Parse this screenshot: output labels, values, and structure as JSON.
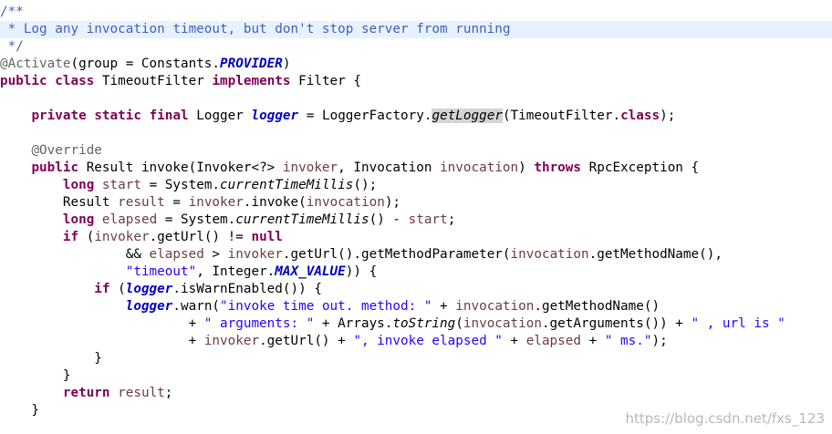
{
  "editor": {
    "highlighted_line": 1,
    "lines": [
      [
        {
          "t": "/**",
          "k": "comment"
        }
      ],
      [
        {
          "t": " * Log any invocation timeout, but don't stop server from running",
          "k": "comment"
        }
      ],
      [
        {
          "t": " */",
          "k": "comment"
        }
      ],
      [
        {
          "t": "@Activate",
          "k": "annotation"
        },
        {
          "t": "(group = Constants.",
          "k": "plain"
        },
        {
          "t": "PROVIDER",
          "k": "static-constant"
        },
        {
          "t": ")",
          "k": "plain"
        }
      ],
      [
        {
          "t": "public",
          "k": "keyword"
        },
        {
          "t": " ",
          "k": "plain"
        },
        {
          "t": "class",
          "k": "keyword"
        },
        {
          "t": " TimeoutFilter ",
          "k": "plain"
        },
        {
          "t": "implements",
          "k": "keyword"
        },
        {
          "t": " Filter {",
          "k": "plain"
        }
      ],
      [],
      [
        {
          "t": "    ",
          "k": "plain"
        },
        {
          "t": "private",
          "k": "keyword"
        },
        {
          "t": " ",
          "k": "plain"
        },
        {
          "t": "static",
          "k": "keyword"
        },
        {
          "t": " ",
          "k": "plain"
        },
        {
          "t": "final",
          "k": "keyword"
        },
        {
          "t": " Logger ",
          "k": "plain"
        },
        {
          "t": "logger",
          "k": "static-field"
        },
        {
          "t": " = LoggerFactory.",
          "k": "plain"
        },
        {
          "t": "getLogger",
          "k": "static-method-marked"
        },
        {
          "t": "(TimeoutFilter.",
          "k": "plain"
        },
        {
          "t": "class",
          "k": "keyword"
        },
        {
          "t": ");",
          "k": "plain"
        }
      ],
      [],
      [
        {
          "t": "    ",
          "k": "plain"
        },
        {
          "t": "@Override",
          "k": "annotation"
        }
      ],
      [
        {
          "t": "    ",
          "k": "plain"
        },
        {
          "t": "public",
          "k": "keyword"
        },
        {
          "t": " Result invoke(Invoker<?> ",
          "k": "plain"
        },
        {
          "t": "invoker",
          "k": "local"
        },
        {
          "t": ", Invocation ",
          "k": "plain"
        },
        {
          "t": "invocation",
          "k": "local"
        },
        {
          "t": ") ",
          "k": "plain"
        },
        {
          "t": "throws",
          "k": "keyword"
        },
        {
          "t": " RpcException {",
          "k": "plain"
        }
      ],
      [
        {
          "t": "        ",
          "k": "plain"
        },
        {
          "t": "long",
          "k": "keyword"
        },
        {
          "t": " ",
          "k": "plain"
        },
        {
          "t": "start",
          "k": "local"
        },
        {
          "t": " = System.",
          "k": "plain"
        },
        {
          "t": "currentTimeMillis",
          "k": "static-method"
        },
        {
          "t": "();",
          "k": "plain"
        }
      ],
      [
        {
          "t": "        Result ",
          "k": "plain"
        },
        {
          "t": "result",
          "k": "local"
        },
        {
          "t": " = ",
          "k": "plain"
        },
        {
          "t": "invoker",
          "k": "local"
        },
        {
          "t": ".invoke(",
          "k": "plain"
        },
        {
          "t": "invocation",
          "k": "local"
        },
        {
          "t": ");",
          "k": "plain"
        }
      ],
      [
        {
          "t": "        ",
          "k": "plain"
        },
        {
          "t": "long",
          "k": "keyword"
        },
        {
          "t": " ",
          "k": "plain"
        },
        {
          "t": "elapsed",
          "k": "local"
        },
        {
          "t": " = System.",
          "k": "plain"
        },
        {
          "t": "currentTimeMillis",
          "k": "static-method"
        },
        {
          "t": "() - ",
          "k": "plain"
        },
        {
          "t": "start",
          "k": "local"
        },
        {
          "t": ";",
          "k": "plain"
        }
      ],
      [
        {
          "t": "        ",
          "k": "plain"
        },
        {
          "t": "if",
          "k": "keyword"
        },
        {
          "t": " (",
          "k": "plain"
        },
        {
          "t": "invoker",
          "k": "local"
        },
        {
          "t": ".getUrl() != ",
          "k": "plain"
        },
        {
          "t": "null",
          "k": "keyword"
        }
      ],
      [
        {
          "t": "                && ",
          "k": "plain"
        },
        {
          "t": "elapsed",
          "k": "local"
        },
        {
          "t": " > ",
          "k": "plain"
        },
        {
          "t": "invoker",
          "k": "local"
        },
        {
          "t": ".getUrl().getMethodParameter(",
          "k": "plain"
        },
        {
          "t": "invocation",
          "k": "local"
        },
        {
          "t": ".getMethodName(),",
          "k": "plain"
        }
      ],
      [
        {
          "t": "                ",
          "k": "plain"
        },
        {
          "t": "\"timeout\"",
          "k": "string"
        },
        {
          "t": ", Integer.",
          "k": "plain"
        },
        {
          "t": "MAX_VALUE",
          "k": "static-constant"
        },
        {
          "t": ")) {",
          "k": "plain"
        }
      ],
      [
        {
          "t": "            ",
          "k": "plain"
        },
        {
          "t": "if",
          "k": "keyword"
        },
        {
          "t": " (",
          "k": "plain"
        },
        {
          "t": "logger",
          "k": "static-field"
        },
        {
          "t": ".isWarnEnabled()) {",
          "k": "plain"
        }
      ],
      [
        {
          "t": "                ",
          "k": "plain"
        },
        {
          "t": "logger",
          "k": "static-field"
        },
        {
          "t": ".warn(",
          "k": "plain"
        },
        {
          "t": "\"invoke time out. method: \"",
          "k": "string"
        },
        {
          "t": " + ",
          "k": "plain"
        },
        {
          "t": "invocation",
          "k": "local"
        },
        {
          "t": ".getMethodName()",
          "k": "plain"
        }
      ],
      [
        {
          "t": "                        + ",
          "k": "plain"
        },
        {
          "t": "\" arguments: \"",
          "k": "string"
        },
        {
          "t": " + Arrays.",
          "k": "plain"
        },
        {
          "t": "toString",
          "k": "static-method"
        },
        {
          "t": "(",
          "k": "plain"
        },
        {
          "t": "invocation",
          "k": "local"
        },
        {
          "t": ".getArguments()) + ",
          "k": "plain"
        },
        {
          "t": "\" , url is \"",
          "k": "string"
        }
      ],
      [
        {
          "t": "                        + ",
          "k": "plain"
        },
        {
          "t": "invoker",
          "k": "local"
        },
        {
          "t": ".getUrl() + ",
          "k": "plain"
        },
        {
          "t": "\", invoke elapsed \"",
          "k": "string"
        },
        {
          "t": " + ",
          "k": "plain"
        },
        {
          "t": "elapsed",
          "k": "local"
        },
        {
          "t": " + ",
          "k": "plain"
        },
        {
          "t": "\" ms.\"",
          "k": "string"
        },
        {
          "t": ");",
          "k": "plain"
        }
      ],
      [
        {
          "t": "            }",
          "k": "plain"
        }
      ],
      [
        {
          "t": "        }",
          "k": "plain"
        }
      ],
      [
        {
          "t": "        ",
          "k": "plain"
        },
        {
          "t": "return",
          "k": "keyword"
        },
        {
          "t": " ",
          "k": "plain"
        },
        {
          "t": "result",
          "k": "local"
        },
        {
          "t": ";",
          "k": "plain"
        }
      ],
      [
        {
          "t": "    }",
          "k": "plain"
        }
      ]
    ]
  },
  "watermark": "https://blog.csdn.net/fxs_123"
}
